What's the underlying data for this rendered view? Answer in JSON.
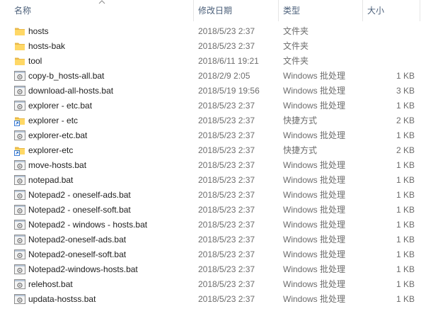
{
  "columns": {
    "name": "名称",
    "date": "修改日期",
    "type": "类型",
    "size": "大小"
  },
  "files": [
    {
      "name": "hosts",
      "date": "2018/5/23 2:37",
      "type": "文件夹",
      "size": "",
      "icon": "folder-icon"
    },
    {
      "name": "hosts-bak",
      "date": "2018/5/23 2:37",
      "type": "文件夹",
      "size": "",
      "icon": "folder-icon"
    },
    {
      "name": "tool",
      "date": "2018/6/11 19:21",
      "type": "文件夹",
      "size": "",
      "icon": "folder-icon"
    },
    {
      "name": "copy-b_hosts-all.bat",
      "date": "2018/2/9 2:05",
      "type": "Windows 批处理",
      "size": "1 KB",
      "icon": "batch-file-icon"
    },
    {
      "name": "download-all-hosts.bat",
      "date": "2018/5/19 19:56",
      "type": "Windows 批处理",
      "size": "3 KB",
      "icon": "batch-file-icon"
    },
    {
      "name": "explorer - etc.bat",
      "date": "2018/5/23 2:37",
      "type": "Windows 批处理",
      "size": "1 KB",
      "icon": "batch-file-icon"
    },
    {
      "name": "explorer - etc",
      "date": "2018/5/23 2:37",
      "type": "快捷方式",
      "size": "2 KB",
      "icon": "shortcut-icon"
    },
    {
      "name": "explorer-etc.bat",
      "date": "2018/5/23 2:37",
      "type": "Windows 批处理",
      "size": "1 KB",
      "icon": "batch-file-icon"
    },
    {
      "name": "explorer-etc",
      "date": "2018/5/23 2:37",
      "type": "快捷方式",
      "size": "2 KB",
      "icon": "shortcut-icon"
    },
    {
      "name": "move-hosts.bat",
      "date": "2018/5/23 2:37",
      "type": "Windows 批处理",
      "size": "1 KB",
      "icon": "batch-file-icon"
    },
    {
      "name": "notepad.bat",
      "date": "2018/5/23 2:37",
      "type": "Windows 批处理",
      "size": "1 KB",
      "icon": "batch-file-icon"
    },
    {
      "name": "Notepad2 -  oneself-ads.bat",
      "date": "2018/5/23 2:37",
      "type": "Windows 批处理",
      "size": "1 KB",
      "icon": "batch-file-icon"
    },
    {
      "name": "Notepad2 -  oneself-soft.bat",
      "date": "2018/5/23 2:37",
      "type": "Windows 批处理",
      "size": "1 KB",
      "icon": "batch-file-icon"
    },
    {
      "name": "Notepad2 -  windows - hosts.bat",
      "date": "2018/5/23 2:37",
      "type": "Windows 批处理",
      "size": "1 KB",
      "icon": "batch-file-icon"
    },
    {
      "name": "Notepad2-oneself-ads.bat",
      "date": "2018/5/23 2:37",
      "type": "Windows 批处理",
      "size": "1 KB",
      "icon": "batch-file-icon"
    },
    {
      "name": "Notepad2-oneself-soft.bat",
      "date": "2018/5/23 2:37",
      "type": "Windows 批处理",
      "size": "1 KB",
      "icon": "batch-file-icon"
    },
    {
      "name": "Notepad2-windows-hosts.bat",
      "date": "2018/5/23 2:37",
      "type": "Windows 批处理",
      "size": "1 KB",
      "icon": "batch-file-icon"
    },
    {
      "name": "relehost.bat",
      "date": "2018/5/23 2:37",
      "type": "Windows 批处理",
      "size": "1 KB",
      "icon": "batch-file-icon"
    },
    {
      "name": "updata-hostss.bat",
      "date": "2018/5/23 2:37",
      "type": "Windows 批处理",
      "size": "1 KB",
      "icon": "batch-file-icon"
    }
  ]
}
